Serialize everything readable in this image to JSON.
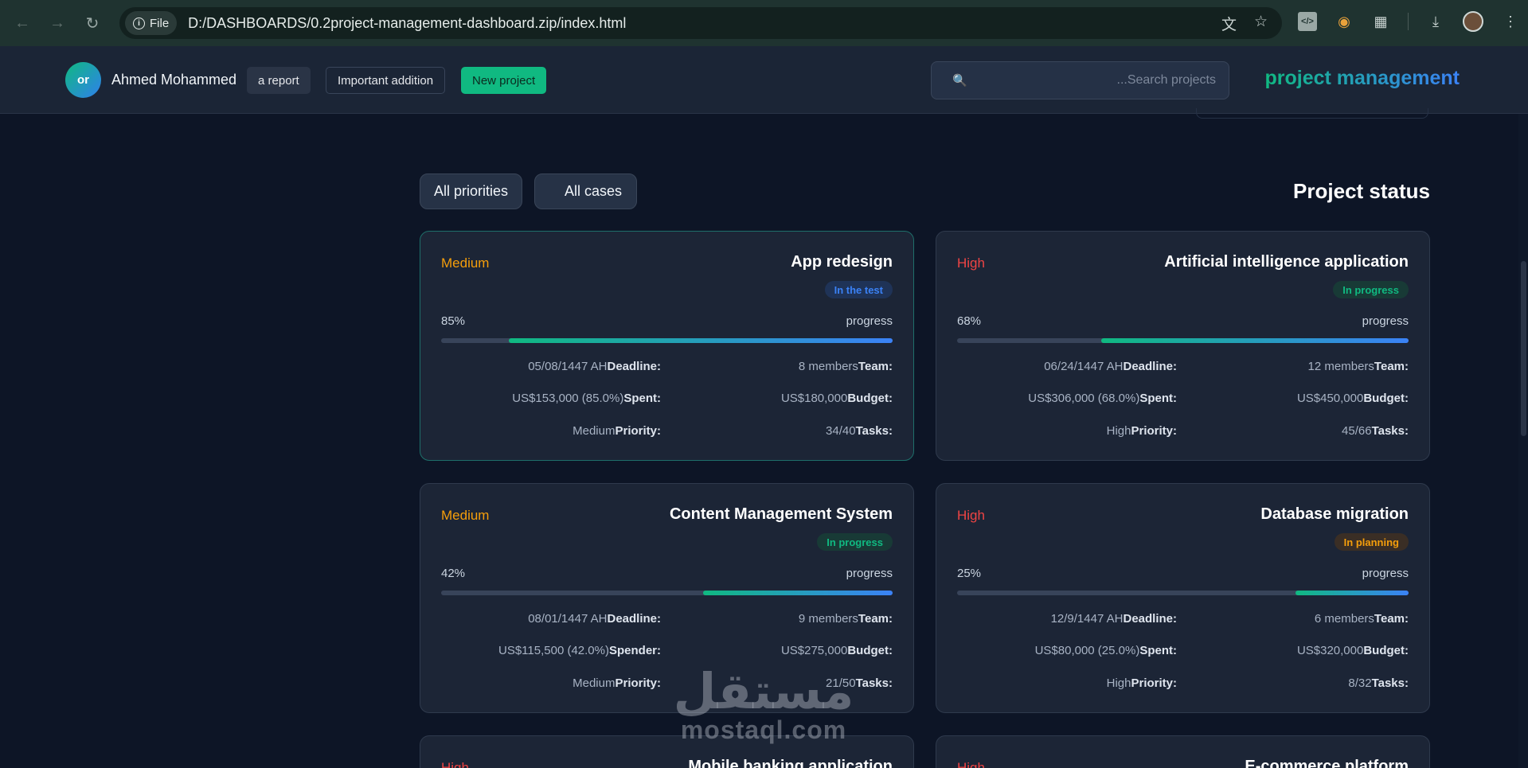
{
  "browser": {
    "file_chip": "File",
    "url": "D:/DASHBOARDS/0.2project-management-dashboard.zip/index.html"
  },
  "header": {
    "avatar_initials": "or",
    "user_name": "Ahmed Mohammed",
    "report_label": "a report",
    "addition_label": "Important addition",
    "new_project_label": "New project",
    "search_placeholder": "...Search projects",
    "brand": "project management"
  },
  "filters": {
    "priority_label": "All priorities",
    "cases_label": "All cases",
    "section_title": "Project status"
  },
  "cards": [
    {
      "title": "App redesign",
      "priority": "Medium",
      "status": "In the test",
      "percent": "85%",
      "progress_label": "progress",
      "progress_value": 85,
      "deadline_key": "Deadline:",
      "deadline_val": "05/08/1447 AH",
      "team_key": "Team:",
      "team_val": "8 members",
      "spent_key": "Spent:",
      "spent_val": "US$153,000 (85.0%)",
      "budget_key": "Budget:",
      "budget_val": "US$180,000",
      "priority_key": "Priority:",
      "priority_val": "Medium",
      "tasks_key": "Tasks:",
      "tasks_val": "34/40"
    },
    {
      "title": "Artificial intelligence application",
      "priority": "High",
      "status": "In progress",
      "percent": "68%",
      "progress_label": "progress",
      "progress_value": 68,
      "deadline_key": "Deadline:",
      "deadline_val": "06/24/1447 AH",
      "team_key": "Team:",
      "team_val": "12 members",
      "spent_key": "Spent:",
      "spent_val": "US$306,000 (68.0%)",
      "budget_key": "Budget:",
      "budget_val": "US$450,000",
      "priority_key": "Priority:",
      "priority_val": "High",
      "tasks_key": "Tasks:",
      "tasks_val": "45/66"
    },
    {
      "title": "Content Management System",
      "priority": "Medium",
      "status": "In progress",
      "percent": "42%",
      "progress_label": "progress",
      "progress_value": 42,
      "deadline_key": "Deadline:",
      "deadline_val": "08/01/1447 AH",
      "team_key": "Team:",
      "team_val": "9 members",
      "spent_key": "Spender:",
      "spent_val": "US$115,500 (42.0%)",
      "budget_key": "Budget:",
      "budget_val": "US$275,000",
      "priority_key": "Priority:",
      "priority_val": "Medium",
      "tasks_key": "Tasks:",
      "tasks_val": "21/50"
    },
    {
      "title": "Database migration",
      "priority": "High",
      "status": "In planning",
      "percent": "25%",
      "progress_label": "progress",
      "progress_value": 25,
      "deadline_key": "Deadline:",
      "deadline_val": "12/9/1447 AH",
      "team_key": "Team:",
      "team_val": "6 members",
      "spent_key": "Spent:",
      "spent_val": "US$80,000 (25.0%)",
      "budget_key": "Budget:",
      "budget_val": "US$320,000",
      "priority_key": "Priority:",
      "priority_val": "High",
      "tasks_key": "Tasks:",
      "tasks_val": "8/32"
    },
    {
      "title": "Mobile banking application",
      "priority": "High"
    },
    {
      "title": "E-commerce platform",
      "priority": "High"
    }
  ],
  "watermark": {
    "arabic": "مستقل",
    "latin": "mostaql.com"
  },
  "colors": {
    "background": "#0d1526",
    "card": "#1c2536",
    "accent_green": "#10b981",
    "accent_blue": "#3b82f6",
    "medium": "#f59e0b",
    "high": "#ef4444"
  }
}
